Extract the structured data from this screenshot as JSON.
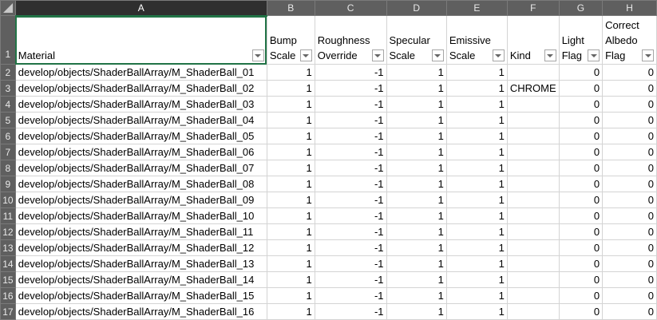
{
  "columns": [
    "A",
    "B",
    "C",
    "D",
    "E",
    "F",
    "G",
    "H"
  ],
  "headers": [
    "Material",
    "Bump Scale",
    "Roughness Override",
    "Specular Scale",
    "Emissive Scale",
    "Kind",
    "Light Flag",
    "Correct Albedo Flag"
  ],
  "rows": [
    {
      "n": "2",
      "material": "develop/objects/ShaderBallArray/M_ShaderBall_01",
      "bump": "1",
      "rough": "-1",
      "spec": "1",
      "emis": "1",
      "kind": "",
      "light": "0",
      "albedo": "0"
    },
    {
      "n": "3",
      "material": "develop/objects/ShaderBallArray/M_ShaderBall_02",
      "bump": "1",
      "rough": "-1",
      "spec": "1",
      "emis": "1",
      "kind": "CHROME",
      "light": "0",
      "albedo": "0"
    },
    {
      "n": "4",
      "material": "develop/objects/ShaderBallArray/M_ShaderBall_03",
      "bump": "1",
      "rough": "-1",
      "spec": "1",
      "emis": "1",
      "kind": "",
      "light": "0",
      "albedo": "0"
    },
    {
      "n": "5",
      "material": "develop/objects/ShaderBallArray/M_ShaderBall_04",
      "bump": "1",
      "rough": "-1",
      "spec": "1",
      "emis": "1",
      "kind": "",
      "light": "0",
      "albedo": "0"
    },
    {
      "n": "6",
      "material": "develop/objects/ShaderBallArray/M_ShaderBall_05",
      "bump": "1",
      "rough": "-1",
      "spec": "1",
      "emis": "1",
      "kind": "",
      "light": "0",
      "albedo": "0"
    },
    {
      "n": "7",
      "material": "develop/objects/ShaderBallArray/M_ShaderBall_06",
      "bump": "1",
      "rough": "-1",
      "spec": "1",
      "emis": "1",
      "kind": "",
      "light": "0",
      "albedo": "0"
    },
    {
      "n": "8",
      "material": "develop/objects/ShaderBallArray/M_ShaderBall_07",
      "bump": "1",
      "rough": "-1",
      "spec": "1",
      "emis": "1",
      "kind": "",
      "light": "0",
      "albedo": "0"
    },
    {
      "n": "9",
      "material": "develop/objects/ShaderBallArray/M_ShaderBall_08",
      "bump": "1",
      "rough": "-1",
      "spec": "1",
      "emis": "1",
      "kind": "",
      "light": "0",
      "albedo": "0"
    },
    {
      "n": "10",
      "material": "develop/objects/ShaderBallArray/M_ShaderBall_09",
      "bump": "1",
      "rough": "-1",
      "spec": "1",
      "emis": "1",
      "kind": "",
      "light": "0",
      "albedo": "0"
    },
    {
      "n": "11",
      "material": "develop/objects/ShaderBallArray/M_ShaderBall_10",
      "bump": "1",
      "rough": "-1",
      "spec": "1",
      "emis": "1",
      "kind": "",
      "light": "0",
      "albedo": "0"
    },
    {
      "n": "12",
      "material": "develop/objects/ShaderBallArray/M_ShaderBall_11",
      "bump": "1",
      "rough": "-1",
      "spec": "1",
      "emis": "1",
      "kind": "",
      "light": "0",
      "albedo": "0"
    },
    {
      "n": "13",
      "material": "develop/objects/ShaderBallArray/M_ShaderBall_12",
      "bump": "1",
      "rough": "-1",
      "spec": "1",
      "emis": "1",
      "kind": "",
      "light": "0",
      "albedo": "0"
    },
    {
      "n": "14",
      "material": "develop/objects/ShaderBallArray/M_ShaderBall_13",
      "bump": "1",
      "rough": "-1",
      "spec": "1",
      "emis": "1",
      "kind": "",
      "light": "0",
      "albedo": "0"
    },
    {
      "n": "15",
      "material": "develop/objects/ShaderBallArray/M_ShaderBall_14",
      "bump": "1",
      "rough": "-1",
      "spec": "1",
      "emis": "1",
      "kind": "",
      "light": "0",
      "albedo": "0"
    },
    {
      "n": "16",
      "material": "develop/objects/ShaderBallArray/M_ShaderBall_15",
      "bump": "1",
      "rough": "-1",
      "spec": "1",
      "emis": "1",
      "kind": "",
      "light": "0",
      "albedo": "0"
    },
    {
      "n": "17",
      "material": "develop/objects/ShaderBallArray/M_ShaderBall_16",
      "bump": "1",
      "rough": "-1",
      "spec": "1",
      "emis": "1",
      "kind": "",
      "light": "0",
      "albedo": "0"
    }
  ],
  "header_row_number": "1",
  "accent": "#217346"
}
